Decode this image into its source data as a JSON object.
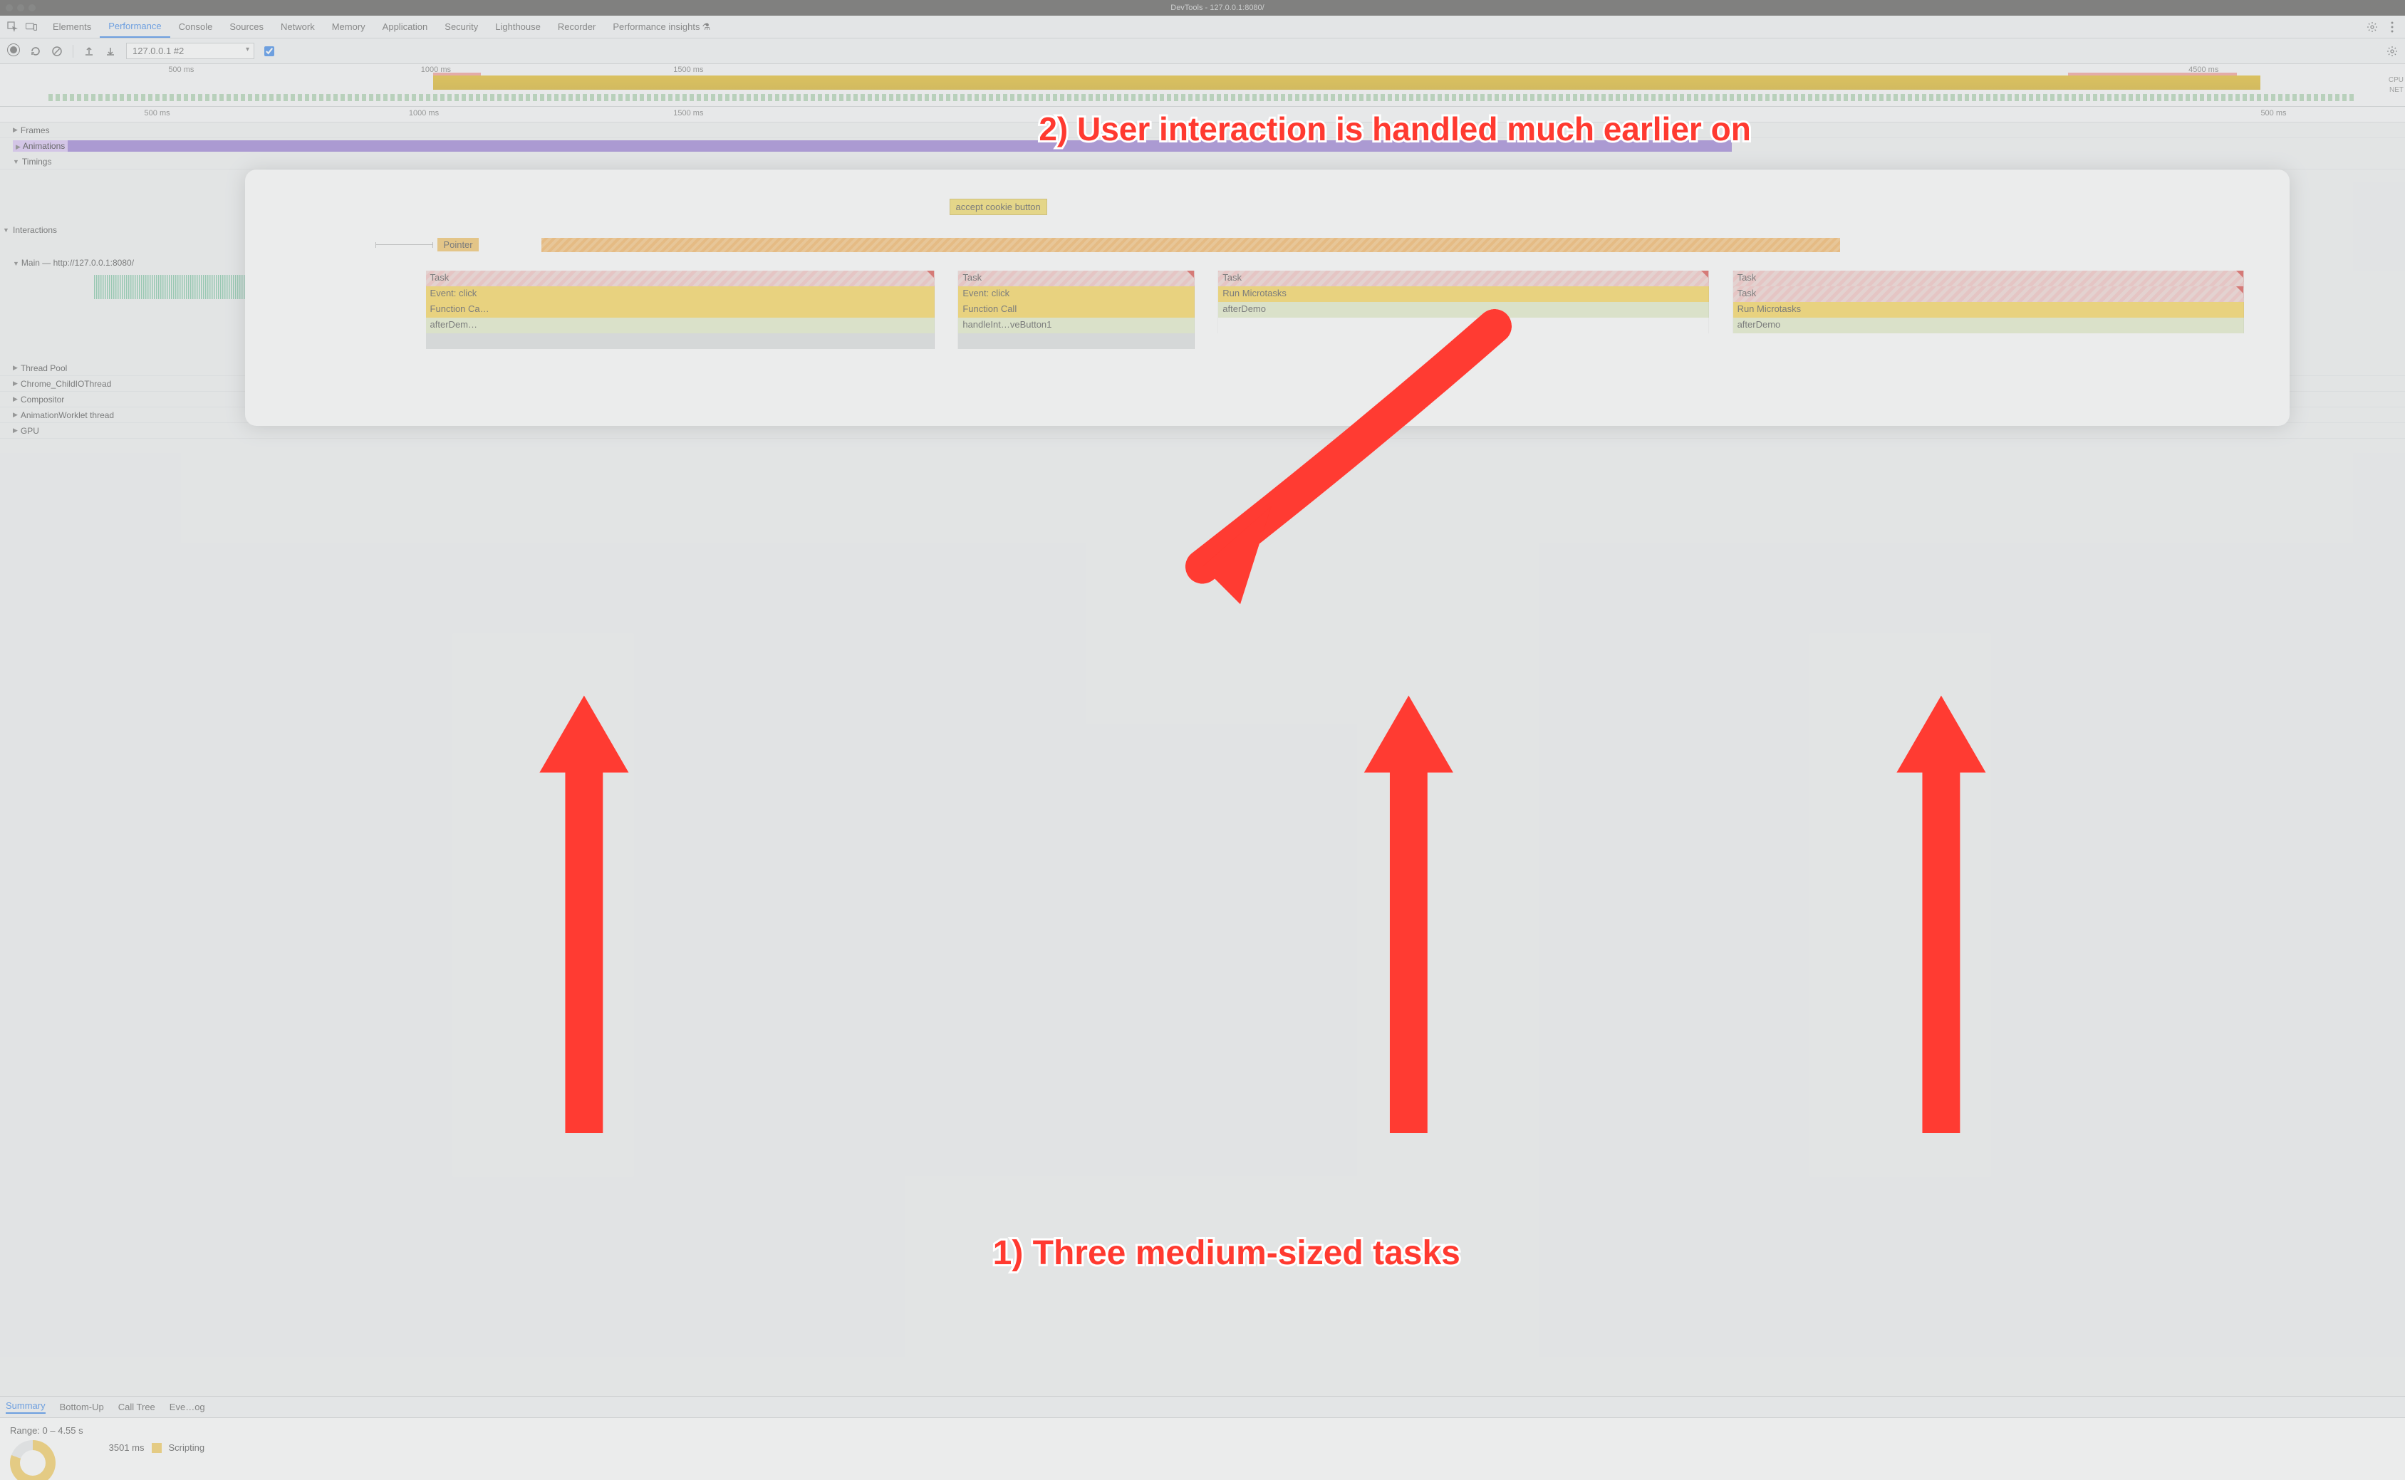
{
  "window": {
    "title": "DevTools - 127.0.0.1:8080/"
  },
  "tabs": {
    "items": [
      "Elements",
      "Performance",
      "Console",
      "Sources",
      "Network",
      "Memory",
      "Application",
      "Security",
      "Lighthouse",
      "Recorder",
      "Performance insights"
    ],
    "active_index": 1,
    "insights_flask": "⚗"
  },
  "toolbar": {
    "recording_select": "127.0.0.1 #2",
    "screenshots_checked": true
  },
  "overview": {
    "ticks": [
      "500 ms",
      "1000 ms",
      "1500 ms",
      "",
      "",
      "",
      "",
      "",
      "4500 ms"
    ],
    "side_labels": [
      "CPU",
      "NET"
    ]
  },
  "time_ruler": {
    "ticks": [
      "500 ms",
      "1000 ms",
      "1500 ms",
      "",
      "",
      "",
      "",
      "",
      "500 ms"
    ]
  },
  "tracks": {
    "frames": "Frames",
    "animations": "Animations",
    "timings": "Timings",
    "interactions": "Interactions",
    "main": "Main — http://127.0.0.1:8080/",
    "thread_pool": "Thread Pool",
    "child_io": "Chrome_ChildIOThread",
    "compositor": "Compositor",
    "anim_worklet": "AnimationWorklet thread",
    "gpu": "GPU"
  },
  "marker": {
    "label": "accept cookie button"
  },
  "pointer": {
    "label": "Pointer"
  },
  "flame": {
    "col_widths_pct": [
      28.0,
      1.3,
      13.0,
      1.3,
      27.0,
      1.3,
      28.1
    ],
    "tasks": {
      "r0": [
        "Task",
        "",
        "Task",
        "",
        "Task",
        "",
        "Task"
      ],
      "r1": [
        "Event: click",
        "",
        "Event: click",
        "",
        "Run Microtasks",
        "",
        "Task"
      ],
      "r2": [
        "Function Ca…",
        "",
        "Function Call",
        "",
        "afterDemo",
        "",
        "Run Microtasks"
      ],
      "r3": [
        "afterDem…",
        "",
        "handleInt…veButton1",
        "",
        "",
        "",
        "afterDemo"
      ]
    }
  },
  "bottom_tabs": {
    "items": [
      "Summary",
      "Bottom-Up",
      "Call Tree",
      "Eve…og"
    ],
    "active_index": 0
  },
  "summary": {
    "range_label": "Range: 0 – 4.55 s",
    "scripting_ms": "3501 ms",
    "scripting_label": "Scripting"
  },
  "annotations": {
    "text1": "2) User interaction is handled much earlier on",
    "text2": "1) Three medium-sized tasks"
  }
}
